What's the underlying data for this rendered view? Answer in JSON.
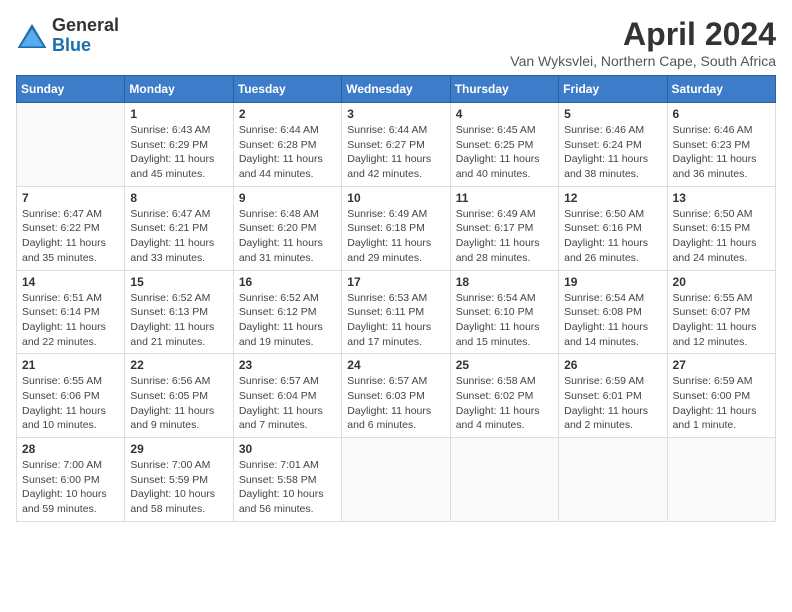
{
  "header": {
    "logo_general": "General",
    "logo_blue": "Blue",
    "title": "April 2024",
    "subtitle": "Van Wyksvlei, Northern Cape, South Africa"
  },
  "weekdays": [
    "Sunday",
    "Monday",
    "Tuesday",
    "Wednesday",
    "Thursday",
    "Friday",
    "Saturday"
  ],
  "weeks": [
    [
      {
        "day": "",
        "info": ""
      },
      {
        "day": "1",
        "info": "Sunrise: 6:43 AM\nSunset: 6:29 PM\nDaylight: 11 hours\nand 45 minutes."
      },
      {
        "day": "2",
        "info": "Sunrise: 6:44 AM\nSunset: 6:28 PM\nDaylight: 11 hours\nand 44 minutes."
      },
      {
        "day": "3",
        "info": "Sunrise: 6:44 AM\nSunset: 6:27 PM\nDaylight: 11 hours\nand 42 minutes."
      },
      {
        "day": "4",
        "info": "Sunrise: 6:45 AM\nSunset: 6:25 PM\nDaylight: 11 hours\nand 40 minutes."
      },
      {
        "day": "5",
        "info": "Sunrise: 6:46 AM\nSunset: 6:24 PM\nDaylight: 11 hours\nand 38 minutes."
      },
      {
        "day": "6",
        "info": "Sunrise: 6:46 AM\nSunset: 6:23 PM\nDaylight: 11 hours\nand 36 minutes."
      }
    ],
    [
      {
        "day": "7",
        "info": "Sunrise: 6:47 AM\nSunset: 6:22 PM\nDaylight: 11 hours\nand 35 minutes."
      },
      {
        "day": "8",
        "info": "Sunrise: 6:47 AM\nSunset: 6:21 PM\nDaylight: 11 hours\nand 33 minutes."
      },
      {
        "day": "9",
        "info": "Sunrise: 6:48 AM\nSunset: 6:20 PM\nDaylight: 11 hours\nand 31 minutes."
      },
      {
        "day": "10",
        "info": "Sunrise: 6:49 AM\nSunset: 6:18 PM\nDaylight: 11 hours\nand 29 minutes."
      },
      {
        "day": "11",
        "info": "Sunrise: 6:49 AM\nSunset: 6:17 PM\nDaylight: 11 hours\nand 28 minutes."
      },
      {
        "day": "12",
        "info": "Sunrise: 6:50 AM\nSunset: 6:16 PM\nDaylight: 11 hours\nand 26 minutes."
      },
      {
        "day": "13",
        "info": "Sunrise: 6:50 AM\nSunset: 6:15 PM\nDaylight: 11 hours\nand 24 minutes."
      }
    ],
    [
      {
        "day": "14",
        "info": "Sunrise: 6:51 AM\nSunset: 6:14 PM\nDaylight: 11 hours\nand 22 minutes."
      },
      {
        "day": "15",
        "info": "Sunrise: 6:52 AM\nSunset: 6:13 PM\nDaylight: 11 hours\nand 21 minutes."
      },
      {
        "day": "16",
        "info": "Sunrise: 6:52 AM\nSunset: 6:12 PM\nDaylight: 11 hours\nand 19 minutes."
      },
      {
        "day": "17",
        "info": "Sunrise: 6:53 AM\nSunset: 6:11 PM\nDaylight: 11 hours\nand 17 minutes."
      },
      {
        "day": "18",
        "info": "Sunrise: 6:54 AM\nSunset: 6:10 PM\nDaylight: 11 hours\nand 15 minutes."
      },
      {
        "day": "19",
        "info": "Sunrise: 6:54 AM\nSunset: 6:08 PM\nDaylight: 11 hours\nand 14 minutes."
      },
      {
        "day": "20",
        "info": "Sunrise: 6:55 AM\nSunset: 6:07 PM\nDaylight: 11 hours\nand 12 minutes."
      }
    ],
    [
      {
        "day": "21",
        "info": "Sunrise: 6:55 AM\nSunset: 6:06 PM\nDaylight: 11 hours\nand 10 minutes."
      },
      {
        "day": "22",
        "info": "Sunrise: 6:56 AM\nSunset: 6:05 PM\nDaylight: 11 hours\nand 9 minutes."
      },
      {
        "day": "23",
        "info": "Sunrise: 6:57 AM\nSunset: 6:04 PM\nDaylight: 11 hours\nand 7 minutes."
      },
      {
        "day": "24",
        "info": "Sunrise: 6:57 AM\nSunset: 6:03 PM\nDaylight: 11 hours\nand 6 minutes."
      },
      {
        "day": "25",
        "info": "Sunrise: 6:58 AM\nSunset: 6:02 PM\nDaylight: 11 hours\nand 4 minutes."
      },
      {
        "day": "26",
        "info": "Sunrise: 6:59 AM\nSunset: 6:01 PM\nDaylight: 11 hours\nand 2 minutes."
      },
      {
        "day": "27",
        "info": "Sunrise: 6:59 AM\nSunset: 6:00 PM\nDaylight: 11 hours\nand 1 minute."
      }
    ],
    [
      {
        "day": "28",
        "info": "Sunrise: 7:00 AM\nSunset: 6:00 PM\nDaylight: 10 hours\nand 59 minutes."
      },
      {
        "day": "29",
        "info": "Sunrise: 7:00 AM\nSunset: 5:59 PM\nDaylight: 10 hours\nand 58 minutes."
      },
      {
        "day": "30",
        "info": "Sunrise: 7:01 AM\nSunset: 5:58 PM\nDaylight: 10 hours\nand 56 minutes."
      },
      {
        "day": "",
        "info": ""
      },
      {
        "day": "",
        "info": ""
      },
      {
        "day": "",
        "info": ""
      },
      {
        "day": "",
        "info": ""
      }
    ]
  ]
}
